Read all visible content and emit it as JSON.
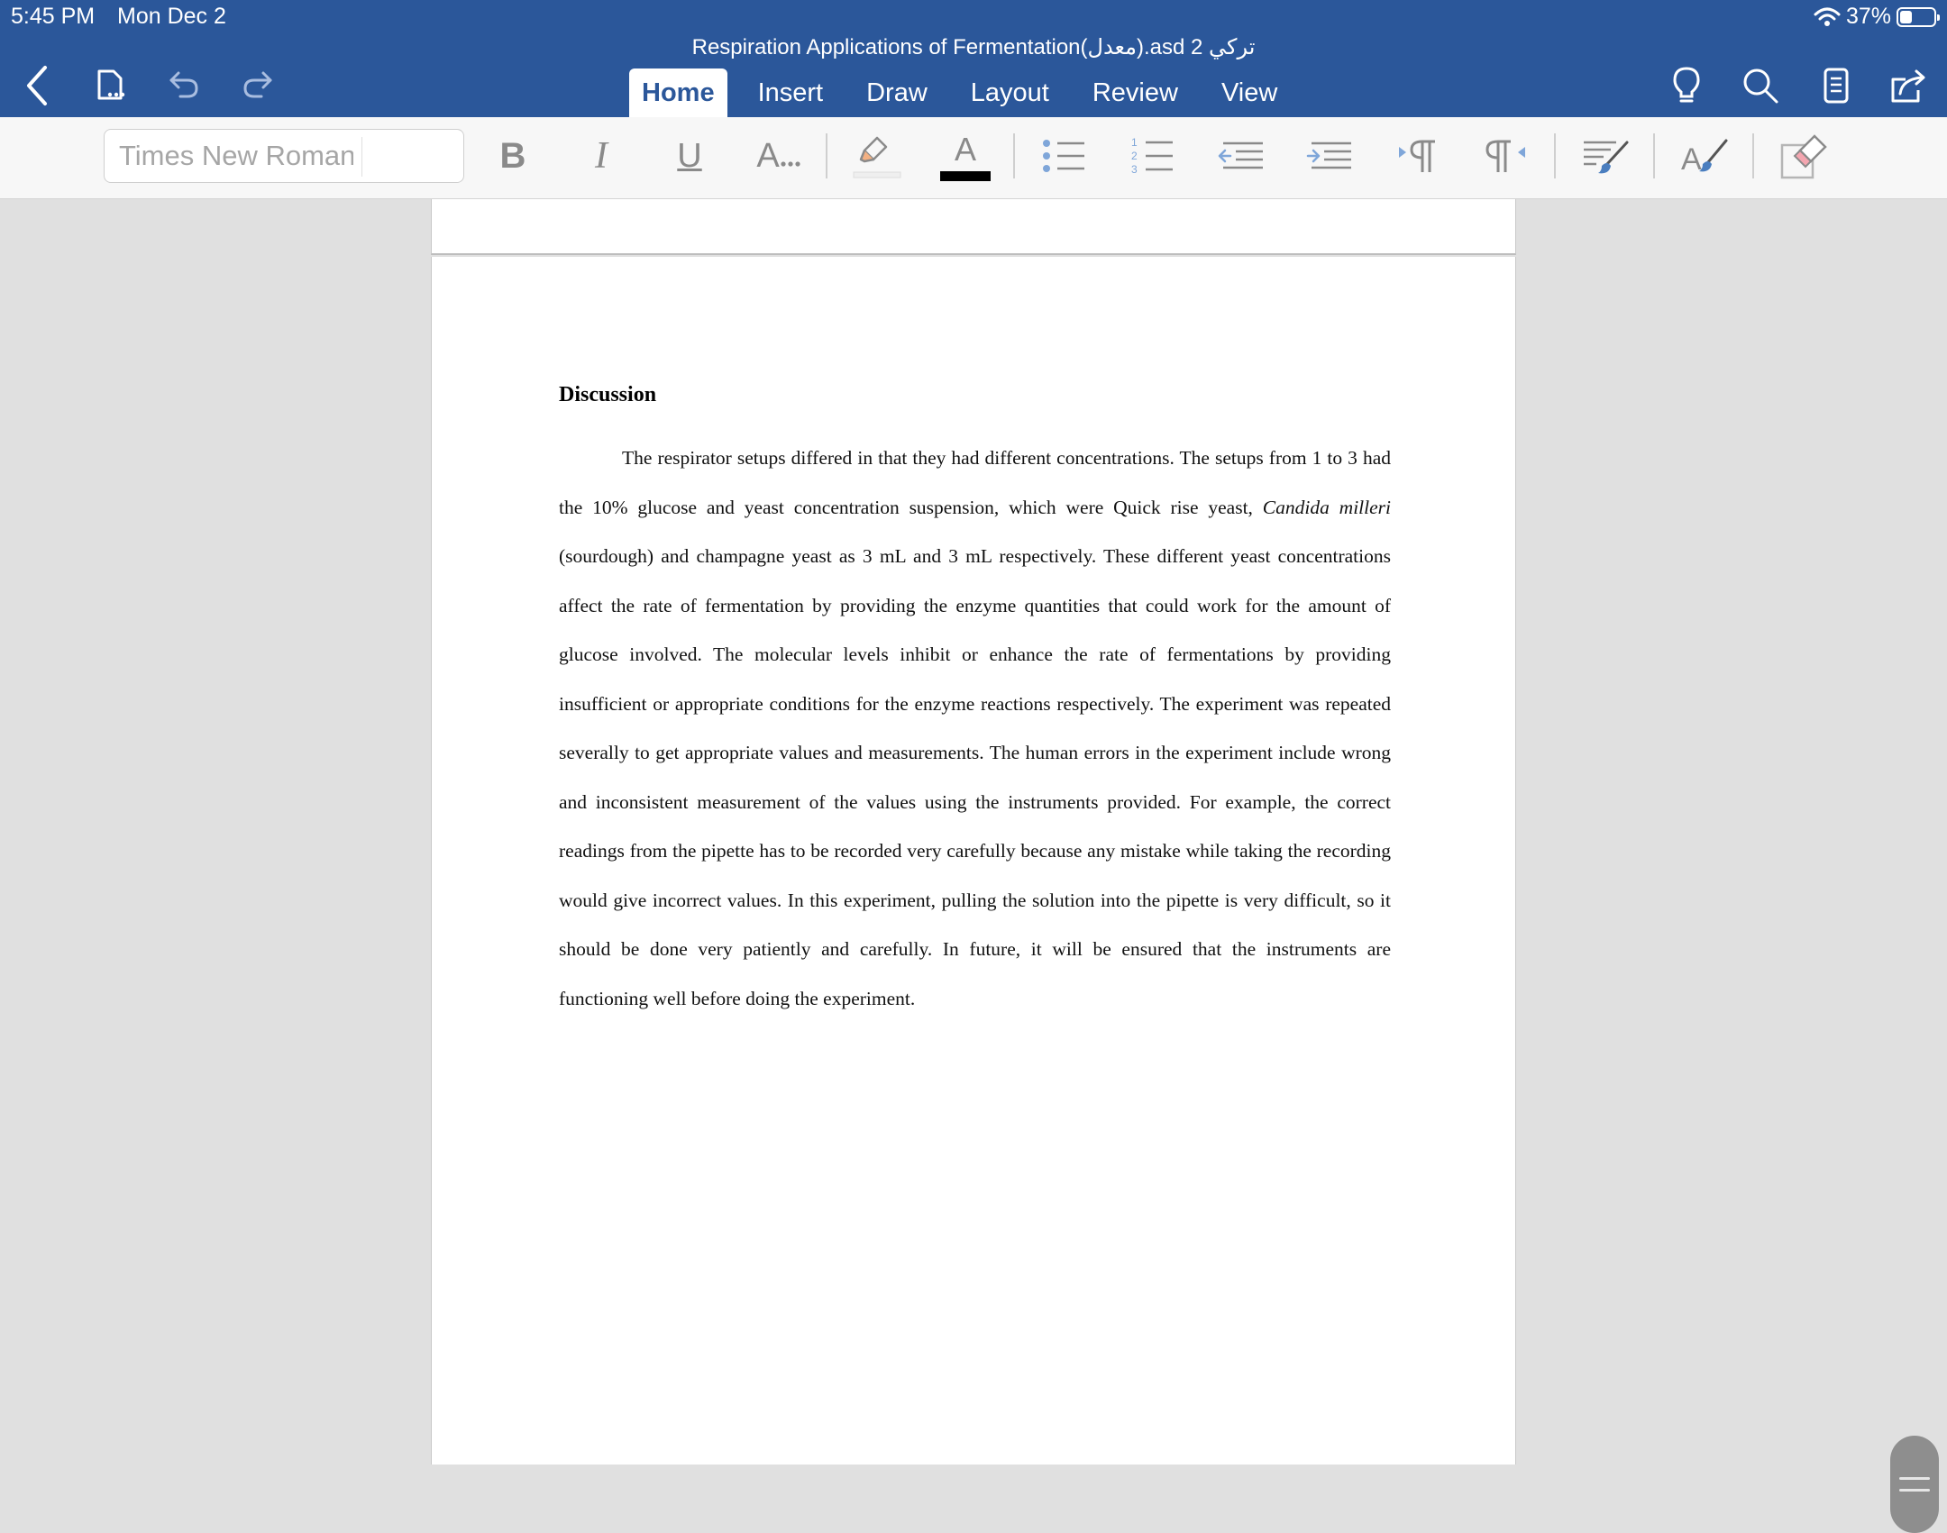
{
  "status_bar": {
    "time": "5:45 PM",
    "date": "Mon Dec 2",
    "battery": "37%",
    "battery_level": 0.37
  },
  "document": {
    "title": "Respiration Applications of Fermentation(معدل).asd 2 تركي"
  },
  "tabs": [
    {
      "label": "Home",
      "active": true
    },
    {
      "label": "Insert"
    },
    {
      "label": "Draw"
    },
    {
      "label": "Layout"
    },
    {
      "label": "Review"
    },
    {
      "label": "View"
    }
  ],
  "ribbon": {
    "font_name": "Times New Roman",
    "bold": "B",
    "italic": "I",
    "underline": "U",
    "text_effects": "A",
    "font_color_glyph": "A",
    "font_color": "#000000",
    "accent_color": "#2b579a"
  },
  "content": {
    "heading": "Discussion",
    "p_before_italic": "The respirator setups differed in that they had different concentrations. The setups from 1 to 3 had the 10% glucose and yeast concentration suspension, which were Quick rise yeast, ",
    "italic": "Candida milleri",
    "p_after_italic": " (sourdough) and champagne yeast as 3 mL and 3 mL respectively. These different yeast concentrations affect the rate of fermentation by providing the enzyme quantities that could work for the amount of glucose involved. The molecular levels inhibit or enhance the rate of fermentations by providing insufficient or appropriate conditions for the enzyme reactions respectively. The experiment was repeated severally to get appropriate values and measurements. The human errors in the experiment include wrong and inconsistent measurement of the values using the instruments provided. For example, the correct readings from the pipette has to be recorded very carefully because any mistake while taking the recording would give incorrect values. In this experiment, pulling the solution into the pipette is very difficult, so it should be done very patiently and carefully. In future, it will be ensured that the instruments are functioning well before doing the experiment."
  },
  "icons": {
    "back": "chevron-left-icon",
    "file": "file-icon",
    "undo": "undo-icon",
    "redo": "redo-icon",
    "tell_me": "lightbulb-icon",
    "search": "search-icon",
    "mobile_view": "mobile-view-icon",
    "share": "share-icon",
    "highlighter": "highlighter-icon",
    "bullets": "bullet-list-icon",
    "numbering": "numbered-list-icon",
    "outdent": "decrease-indent-icon",
    "indent": "increase-indent-icon",
    "ltr": "left-to-right-icon",
    "rtl": "right-to-left-icon",
    "styles": "styles-icon",
    "text_styles": "text-styles-icon",
    "clear_formatting": "clear-formatting-icon"
  }
}
